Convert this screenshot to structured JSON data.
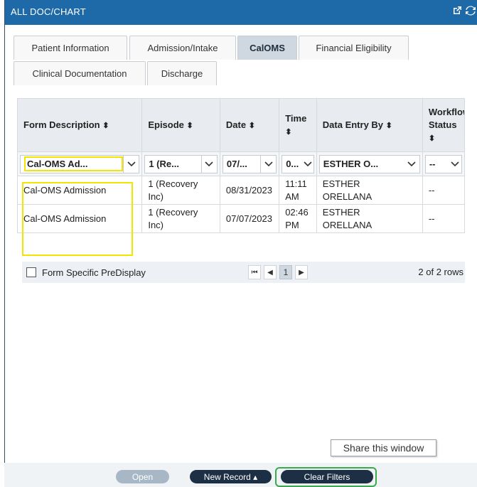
{
  "window": {
    "title": "ALL DOC/CHART",
    "icons": [
      "external-link-icon",
      "refresh-icon"
    ]
  },
  "tabs": {
    "row1": [
      "Patient Information",
      "Admission/Intake",
      "CalOMS",
      "Financial Eligibility"
    ],
    "row2": [
      "Clinical Documentation",
      "Discharge"
    ],
    "active": "CalOMS"
  },
  "table": {
    "headers": {
      "form_description": "Form Description",
      "episode": "Episode",
      "date": "Date",
      "time": "Time",
      "data_entry_by": "Data Entry By",
      "workflow_status_line1": "Workflow",
      "workflow_status_line2": "Status",
      "sort_glyph": "⬍"
    },
    "filters": {
      "form_description": "Cal-OMS Ad...",
      "episode": "1 (Re...",
      "date": "07/...",
      "time": "0...",
      "data_entry_by": "ESTHER O...",
      "workflow_status": "--"
    },
    "rows": [
      {
        "form_description": "Cal-OMS Admission",
        "episode_line1": "1 (Recovery",
        "episode_line2": "Inc)",
        "date": "08/31/2023",
        "time_line1": "11:11",
        "time_line2": "AM",
        "entry_line1": "ESTHER",
        "entry_line2": "ORELLANA",
        "workflow_status": "--"
      },
      {
        "form_description": "Cal-OMS Admission",
        "episode_line1": "1 (Recovery",
        "episode_line2": "Inc)",
        "date": "07/07/2023",
        "time_line1": "02:46",
        "time_line2": "PM",
        "entry_line1": "ESTHER",
        "entry_line2": "ORELLANA",
        "workflow_status": "--"
      }
    ]
  },
  "pager": {
    "checkbox_label": "Form Specific PreDisplay",
    "first": "⏮",
    "prev": "◀",
    "current_page": "1",
    "next": "▶",
    "count": "2 of 2 rows"
  },
  "tooltip": "Share this window",
  "footer": {
    "open": "Open",
    "new_record": "New Record ▴",
    "clear_filters": "Clear Filters"
  },
  "colors": {
    "titlebar": "#1e6aa8",
    "highlight_yellow": "#f2e600",
    "highlight_green": "#3aa94a",
    "button_dark": "#1d2f44",
    "button_disabled": "#a7b7c6"
  }
}
